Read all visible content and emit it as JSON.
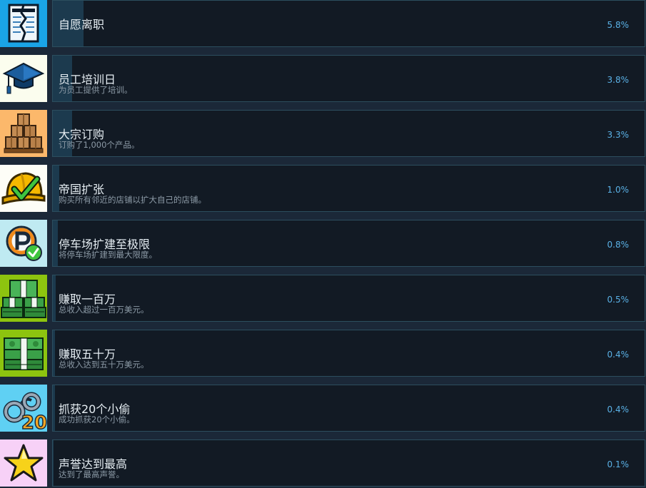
{
  "achievements": [
    {
      "title": "自愿离职",
      "description": "",
      "percent": "5.8%",
      "percent_value": 5.8,
      "icon": "contract-icon",
      "icon_bg": "#1aa4e6"
    },
    {
      "title": "员工培训日",
      "description": "为员工提供了培训。",
      "percent": "3.8%",
      "percent_value": 3.8,
      "icon": "graduation-cap-icon",
      "icon_bg": "#fbfdee"
    },
    {
      "title": "大宗订购",
      "description": "订购了1,000个产品。",
      "percent": "3.3%",
      "percent_value": 3.3,
      "icon": "boxes-icon",
      "icon_bg": "#fcb86b"
    },
    {
      "title": "帝国扩张",
      "description": "购买所有邻近的店铺以扩大自己的店铺。",
      "percent": "1.0%",
      "percent_value": 1.0,
      "icon": "hard-hat-icon",
      "icon_bg": "#fdfdf7"
    },
    {
      "title": "停车场扩建至极限",
      "description": "将停车场扩建到最大限度。",
      "percent": "0.8%",
      "percent_value": 0.8,
      "icon": "parking-sign-icon",
      "icon_bg": "#bfeaf2"
    },
    {
      "title": "赚取一百万",
      "description": "总收入超过一百万美元。",
      "percent": "0.5%",
      "percent_value": 0.5,
      "icon": "money-stacks-icon",
      "icon_bg": "#8dc40f"
    },
    {
      "title": "赚取五十万",
      "description": "总收入达到五十万美元。",
      "percent": "0.4%",
      "percent_value": 0.4,
      "icon": "money-stack-icon",
      "icon_bg": "#8dc40f"
    },
    {
      "title": "抓获20个小偷",
      "description": "成功抓获20个小偷。",
      "percent": "0.4%",
      "percent_value": 0.4,
      "icon": "handcuffs-icon",
      "icon_bg": "#5fd0f3",
      "icon_text": "20"
    },
    {
      "title": "声誉达到最高",
      "description": "达到了最高声誉。",
      "percent": "0.1%",
      "percent_value": 0.1,
      "icon": "star-icon",
      "icon_bg": "#f7d1f7"
    }
  ]
}
